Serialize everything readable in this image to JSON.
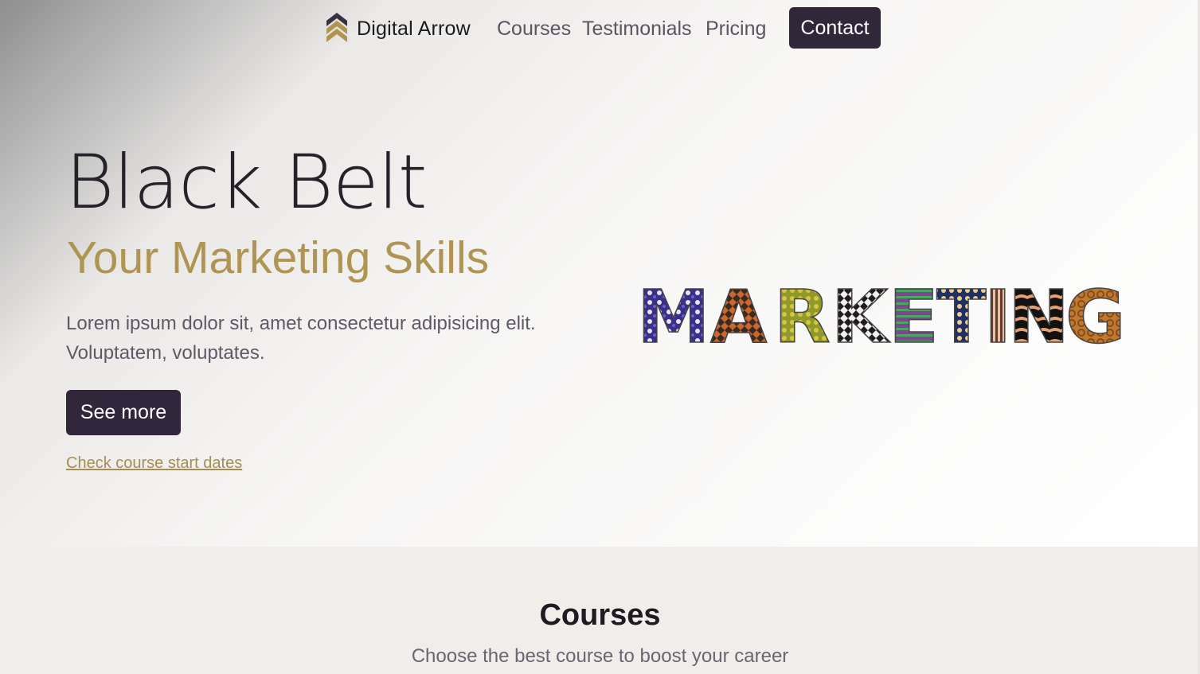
{
  "navbar": {
    "brand": "Digital Arrow",
    "links": [
      {
        "label": "Courses"
      },
      {
        "label": "Testimonials"
      },
      {
        "label": "Pricing"
      }
    ],
    "contact_label": "Contact"
  },
  "hero": {
    "title": "Black Belt",
    "subtitle": "Your Marketing Skills",
    "description": "Lorem ipsum dolor sit, amet consectetur adipisicing elit. Voluptatem, voluptates.",
    "cta_label": "See more",
    "dates_link": "Check course start dates",
    "art_word": "MARKETING"
  },
  "courses": {
    "title": "Courses",
    "subtitle": "Choose the best course to boost your career"
  },
  "colors": {
    "primary": "#32263a",
    "accent": "#b09550",
    "section_bg": "#f0edeb"
  },
  "icons": {
    "brand": "double-chevron-up-icon"
  }
}
